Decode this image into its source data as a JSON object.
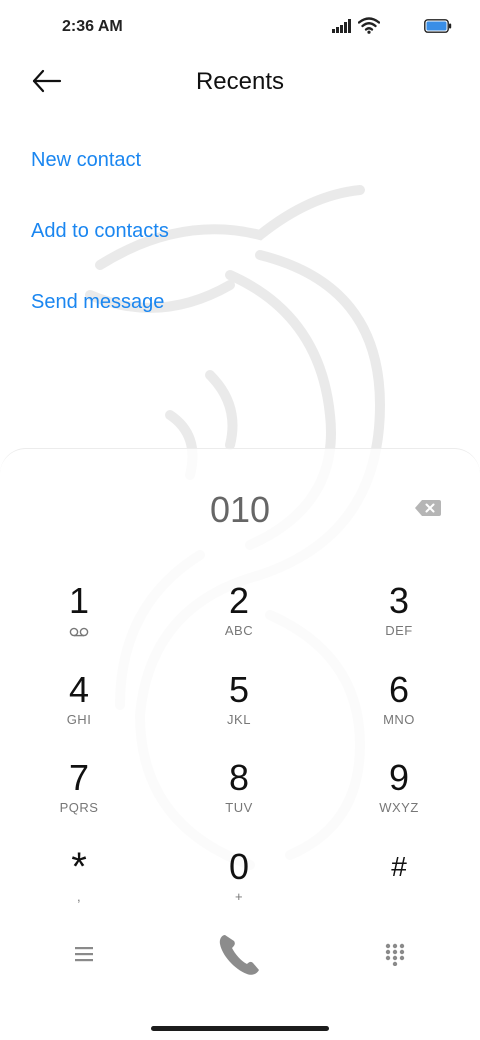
{
  "status_bar": {
    "time": "2:36 AM",
    "icons": [
      "signal-icon",
      "wifi-icon",
      "battery-icon"
    ],
    "battery_color": "#3a8ee6"
  },
  "header": {
    "title": "Recents",
    "back_icon": "arrow-left-icon"
  },
  "actions": [
    {
      "label": "New contact"
    },
    {
      "label": "Add to contacts"
    },
    {
      "label": "Send message"
    }
  ],
  "colors": {
    "accent": "#1a86f0",
    "text": "#111111",
    "secondary_text": "#777777"
  },
  "dialpad": {
    "number": "010",
    "backspace_icon": "backspace-icon",
    "keys": [
      {
        "digit": "1",
        "sub": "",
        "sub_icon": "voicemail-icon"
      },
      {
        "digit": "2",
        "sub": "ABC"
      },
      {
        "digit": "3",
        "sub": "DEF"
      },
      {
        "digit": "4",
        "sub": "GHI"
      },
      {
        "digit": "5",
        "sub": "JKL"
      },
      {
        "digit": "6",
        "sub": "MNO"
      },
      {
        "digit": "7",
        "sub": "PQRS"
      },
      {
        "digit": "8",
        "sub": "TUV"
      },
      {
        "digit": "9",
        "sub": "WXYZ"
      },
      {
        "digit": "*",
        "sub": ","
      },
      {
        "digit": "0",
        "sub": "+"
      },
      {
        "digit": "#",
        "sub": ""
      }
    ]
  },
  "bottom_bar": {
    "menu_icon": "menu-icon",
    "call_icon": "phone-icon",
    "dialpad_icon": "dialpad-grid-icon"
  }
}
